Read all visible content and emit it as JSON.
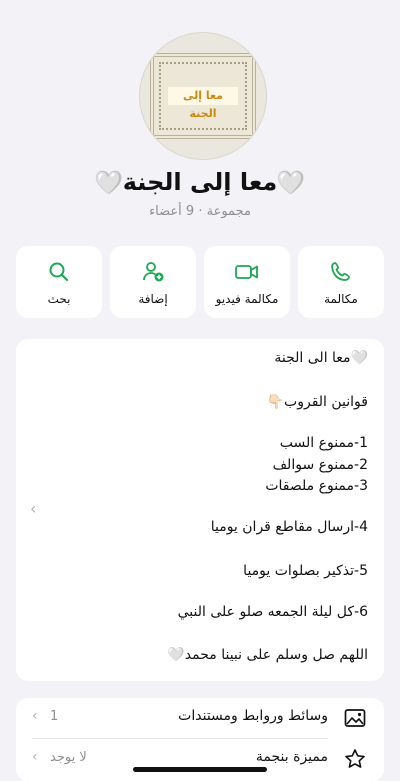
{
  "group": {
    "avatar_text": "معا إلى الجنة",
    "name": "معا إلى الجنة",
    "heart": "🤍",
    "subtitle": "مجموعة · 9 أعضاء"
  },
  "actions": [
    {
      "label": "مكالمة",
      "icon": "phone-icon"
    },
    {
      "label": "مكالمة فيديو",
      "icon": "video-icon"
    },
    {
      "label": "إضافة",
      "icon": "add-person-icon"
    },
    {
      "label": "بحث",
      "icon": "search-icon"
    }
  ],
  "description": {
    "lines": [
      "🤍معا الى الجنة",
      "قوانين القروب👇🏻",
      "1-ممنوع السب",
      "2-ممنوع سوالف",
      "3-ممنوع ملصقات",
      "4-ارسال مقاطع قران يوميا",
      "5-تذكير بصلوات يوميا",
      "6-كل ليلة الجمعه صلو على النبي",
      "اللهم صل وسلم على نبينا محمد🤍"
    ],
    "collapse_chevron": "‹"
  },
  "list": {
    "media": {
      "label": "وسائط وروابط ومستندات",
      "value": "1",
      "icon": "photo-icon"
    },
    "starred": {
      "label": "مميزة بنجمة",
      "value": "لا يوجد",
      "icon": "star-icon"
    }
  },
  "colors": {
    "accent": "#1da851",
    "background": "#f2f2f7"
  }
}
